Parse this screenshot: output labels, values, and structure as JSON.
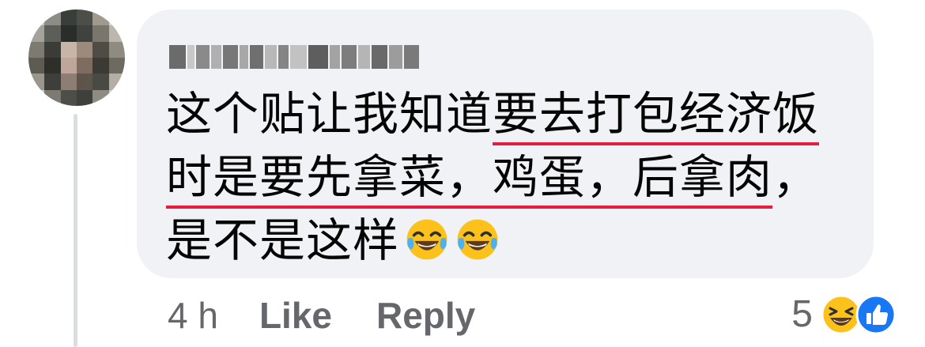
{
  "comment": {
    "author_name": "",
    "text_lines": [
      {
        "before": "这个贴让我知道",
        "underlined": "要去打包经济饭",
        "after": ""
      },
      {
        "before": "",
        "underlined": "时是要先拿菜，鸡蛋，后拿肉",
        "after": "，"
      },
      {
        "before": "是不是这样",
        "underlined": "",
        "after": ""
      }
    ],
    "emojis": [
      "tears-of-joy-emoji",
      "tears-of-joy-emoji"
    ]
  },
  "actions": {
    "timestamp": "4 h",
    "like_label": "Like",
    "reply_label": "Reply"
  },
  "reactions": {
    "count": "5",
    "icons": [
      "laughing-reaction-icon",
      "like-reaction-icon"
    ]
  },
  "colors": {
    "bubble_bg": "#f0f2f5",
    "text": "#050505",
    "meta_text": "#65676b",
    "underline": "#e41e3f",
    "like_blue": "#1877f2"
  }
}
